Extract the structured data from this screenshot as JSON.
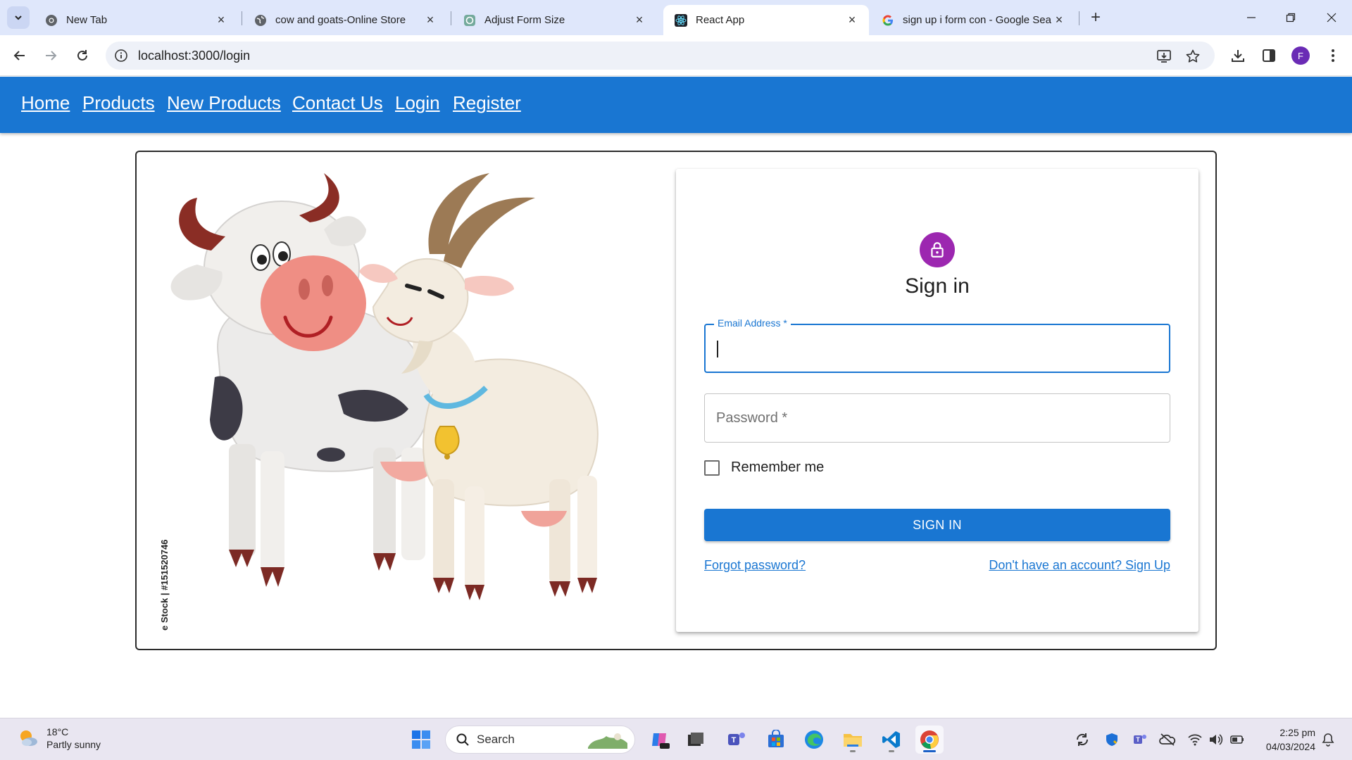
{
  "browser": {
    "tabs": [
      {
        "title": "New Tab",
        "active": false
      },
      {
        "title": "cow and goats-Online Store",
        "active": false
      },
      {
        "title": "Adjust Form Size",
        "active": false
      },
      {
        "title": "React App",
        "active": true
      },
      {
        "title": "sign up i form con - Google Sea",
        "active": false
      }
    ],
    "url": "localhost:3000/login",
    "profile_initial": "F"
  },
  "nav": {
    "items": [
      "Home",
      "Products",
      "New Products",
      "Contact Us",
      "Login",
      "Register"
    ]
  },
  "illustration": {
    "watermark_text": "e Stock | #151520746"
  },
  "signin": {
    "title": "Sign in",
    "email_label": "Email Address *",
    "email_value": "",
    "password_placeholder": "Password *",
    "remember_label": "Remember me",
    "remember_checked": false,
    "button_label": "SIGN IN",
    "forgot_link": "Forgot password?",
    "signup_link": "Don't have an account? Sign Up"
  },
  "colors": {
    "appbar": "#1976d2",
    "lock_badge": "#9c27b0",
    "primary": "#1976d2"
  },
  "taskbar": {
    "temperature": "18°C",
    "weather": "Partly sunny",
    "search_placeholder": "Search",
    "time": "2:25 pm",
    "date": "04/03/2024"
  }
}
